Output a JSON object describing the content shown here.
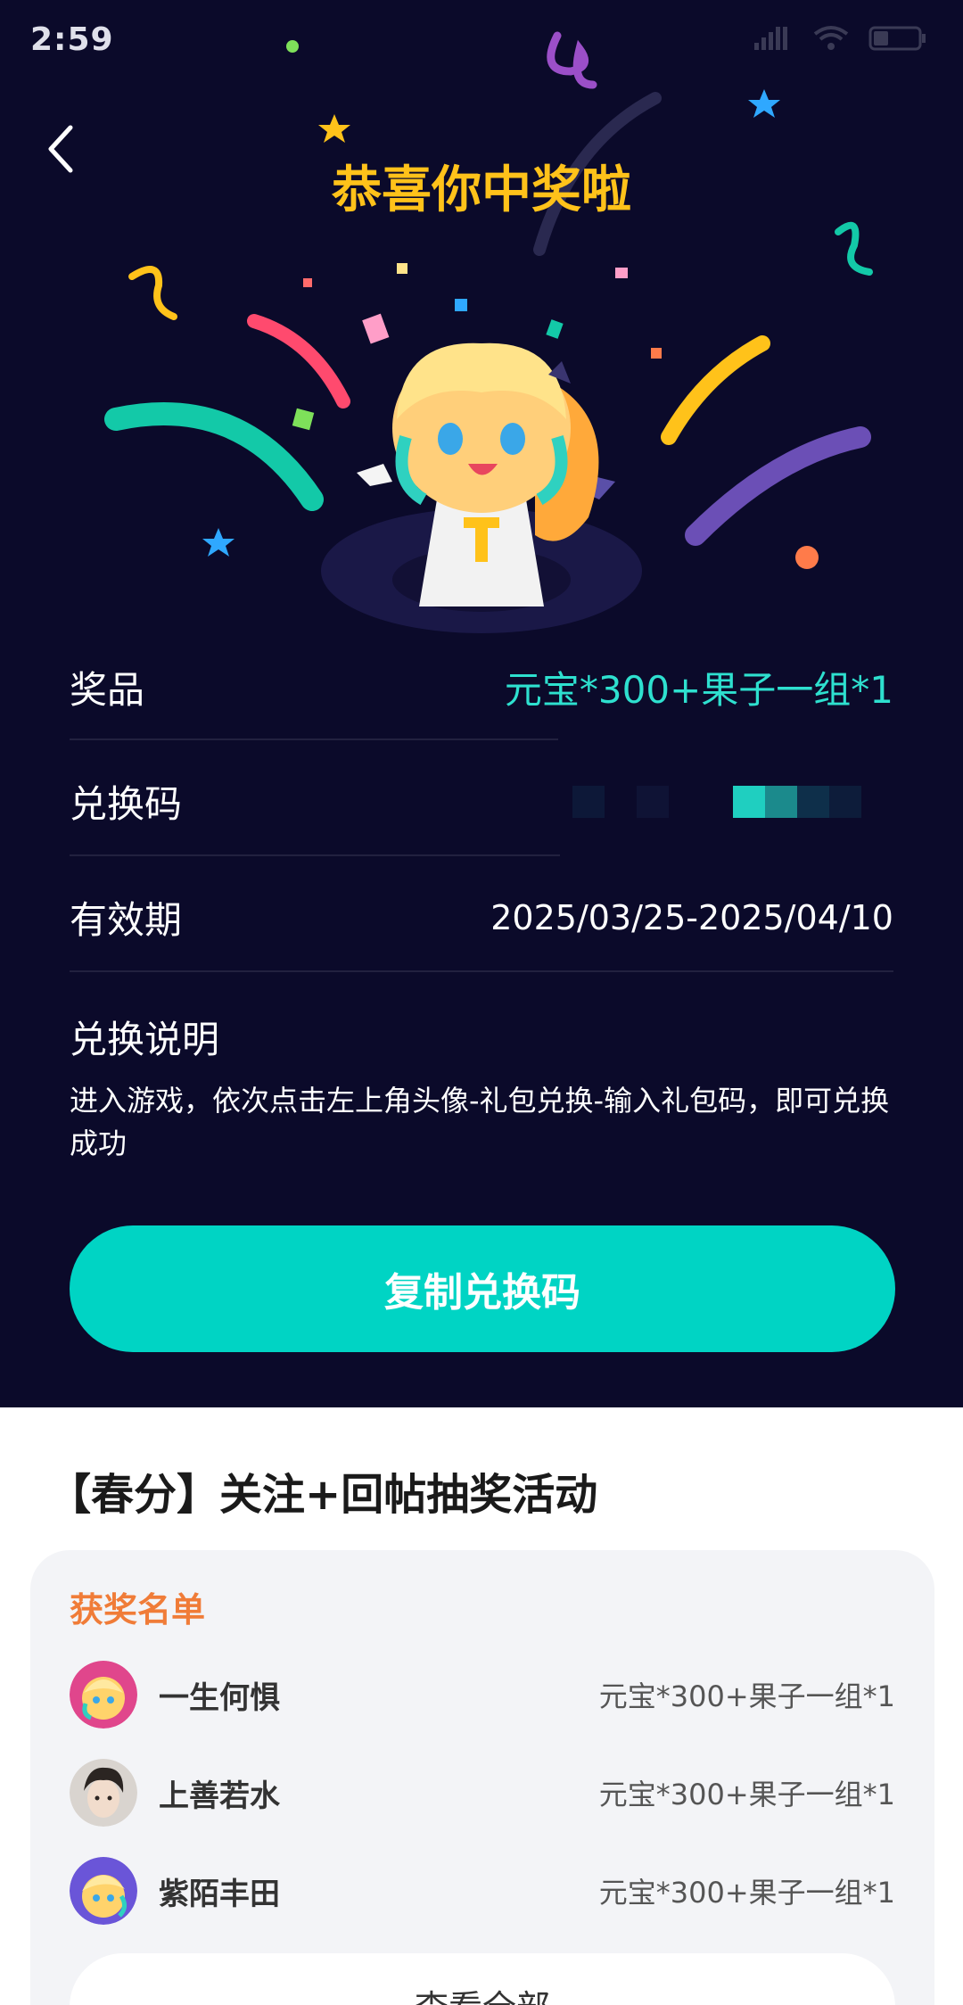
{
  "status": {
    "time": "2:59",
    "battery": "28"
  },
  "hero": {
    "title": "恭喜你中奖啦"
  },
  "prize": {
    "label": "奖品",
    "value": "元宝*300+果子一组*1"
  },
  "code": {
    "label": "兑换码"
  },
  "validity": {
    "label": "有效期",
    "value": "2025/03/25-2025/04/10"
  },
  "instructions": {
    "title": "兑换说明",
    "text": "进入游戏，依次点击左上角头像-礼包兑换-输入礼包码，即可兑换成功"
  },
  "copy_button": {
    "label": "复制兑换码"
  },
  "activity": {
    "title": "【春分】关注+回帖抽奖活动"
  },
  "winners": {
    "heading": "获奖名单",
    "list": [
      {
        "name": "一生何惧",
        "prize": "元宝*300+果子一组*1"
      },
      {
        "name": "上善若水",
        "prize": "元宝*300+果子一组*1"
      },
      {
        "name": "紫陌丰田",
        "prize": "元宝*300+果子一组*1"
      }
    ],
    "view_all": "查看全部"
  },
  "colors": {
    "hero_bg": "#0b0a2a",
    "title_gold": "#ffc21a",
    "accent_teal": "#00d4c4",
    "winners_orange": "#f07c38"
  },
  "icons": [
    "back-chevron-icon",
    "signal-icon",
    "wifi-icon",
    "battery-icon"
  ]
}
